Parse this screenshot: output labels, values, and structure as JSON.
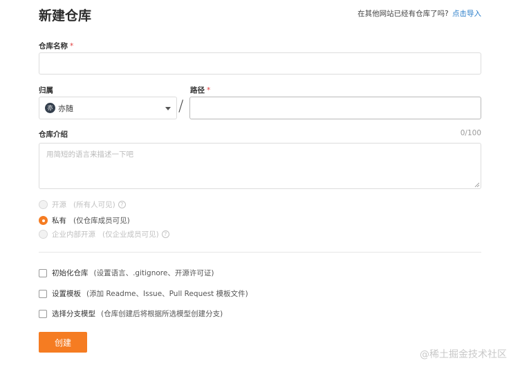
{
  "page": {
    "title": "新建仓库",
    "import_hint": "在其他网站已经有仓库了吗?",
    "import_link": "点击导入"
  },
  "form": {
    "repo_name": {
      "label": "仓库名称",
      "required_mark": "*",
      "value": ""
    },
    "owner": {
      "label": "归属",
      "avatar_text": "亦",
      "selected": "亦随"
    },
    "separator": "/",
    "path": {
      "label": "路径",
      "required_mark": "*",
      "value": ""
    },
    "description": {
      "label": "仓库介绍",
      "counter": "0/100",
      "placeholder": "用简短的语言来描述一下吧"
    },
    "help_glyph": "?",
    "visibility": [
      {
        "label": "开源",
        "sub": "(所有人可见)",
        "checked": false,
        "disabled": true,
        "help": true
      },
      {
        "label": "私有",
        "sub": "(仅仓库成员可见)",
        "checked": true,
        "disabled": false,
        "help": false
      },
      {
        "label": "企业内部开源",
        "sub": "(仅企业成员可见)",
        "checked": false,
        "disabled": true,
        "help": true
      }
    ],
    "options": [
      {
        "label": "初始化仓库",
        "sub": "(设置语言、.gitignore、开源许可证)"
      },
      {
        "label": "设置模板",
        "sub": "(添加 Readme、Issue、Pull Request 模板文件)"
      },
      {
        "label": "选择分支模型",
        "sub": "(仓库创建后将根据所选模型创建分支)"
      }
    ],
    "submit_label": "创建"
  },
  "watermark": "@稀土掘金技术社区",
  "colors": {
    "accent": "#f57c22",
    "link": "#2a7dc9",
    "required": "#e23c3c"
  }
}
